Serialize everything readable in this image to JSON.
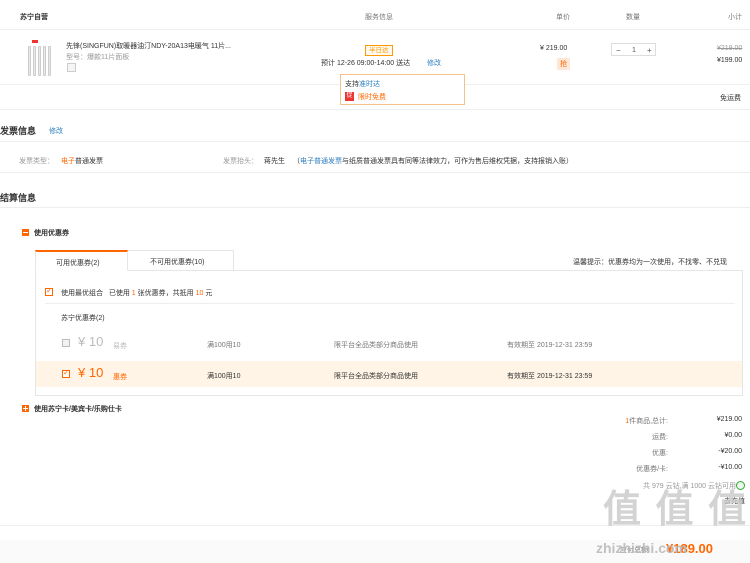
{
  "header": {
    "store": "苏宁自营",
    "service_col": "服务信息",
    "price_col": "单价",
    "qty_col": "数量",
    "subtotal_col": "小计"
  },
  "item": {
    "title": "先锋(SINGFUN)取暖器油汀NDY-20A13电暖气 11片...",
    "model": "型号：爆款11片面板",
    "delivery_badge": "半日达",
    "delivery_time": "预计 12-26 09:00-14:00 送达",
    "delivery_edit": "修改",
    "price": "¥ 219.00",
    "price_tag": "抢",
    "quantity": "1",
    "qty_minus": "−",
    "qty_plus": "+",
    "subtotal_original": "¥219.00",
    "subtotal": "¥199.00",
    "shipping": "免运费",
    "popup_line1_prefix": "支持",
    "popup_line1_link": "准时达",
    "popup_line2_icon": "促",
    "popup_line2": "限时免费"
  },
  "invoice": {
    "title": "发票信息",
    "edit": "修改",
    "type_label": "发票类型：",
    "type_value": "电子",
    "type_value2": "普通发票",
    "head_label": "发票抬头：",
    "head_value": "蒋先生",
    "note_prefix": "（",
    "note_link": "电子普通发票",
    "note_rest": "与纸质普通发票具有同等法律效力，可作为售后维权凭据，支持报销入账）"
  },
  "settlement": {
    "title": "结算信息",
    "coupon_section": "使用优惠券",
    "tab_usable": "可用优惠券(2)",
    "tab_unusable": "不可用优惠券(10)",
    "tip": "温馨提示：优惠券均为一次使用，不找零、不兑现",
    "best_combo": "使用最优组合",
    "used_prefix": "已使用",
    "used_count": "1",
    "used_mid": "张优惠券，共抵用",
    "used_amount": "10",
    "used_suffix": "元",
    "group_title": "苏宁优惠券(2)",
    "coupons": [
      {
        "currency": "¥",
        "amount": "10",
        "type": "易券",
        "rule": "满100用10",
        "scope": "限平台全品类部分商品使用",
        "expiry": "有效期至 2019-12-31 23:59",
        "checked": false
      },
      {
        "currency": "¥",
        "amount": "10",
        "type": "惠券",
        "rule": "满100用10",
        "scope": "限平台全品类部分商品使用",
        "expiry": "有效期至 2019-12-31 23:59",
        "checked": true
      }
    ],
    "card_section": "使用苏宁卡/美宾卡/乐购仕卡"
  },
  "summary": {
    "count_prefix": "1",
    "count_label": "件商品,总计:",
    "total": "¥219.00",
    "freight_label": "运费:",
    "freight": "¥0.00",
    "discount_label": "优惠:",
    "discount": "-¥20.00",
    "coupon_label": "优惠券/卡:",
    "coupon": "-¥10.00",
    "points_line": "共 979 云钻,满 1000 云钻可用",
    "points_action": "去充值",
    "pay_label": "应付总额:",
    "pay_amount": "¥189.00"
  },
  "watermark": {
    "logo": "值 值 值",
    "site": "zhizhizhi.com"
  },
  "colors": {
    "accent": "#ff6600",
    "link": "#2c7fc1",
    "badge": "#ff9900"
  }
}
